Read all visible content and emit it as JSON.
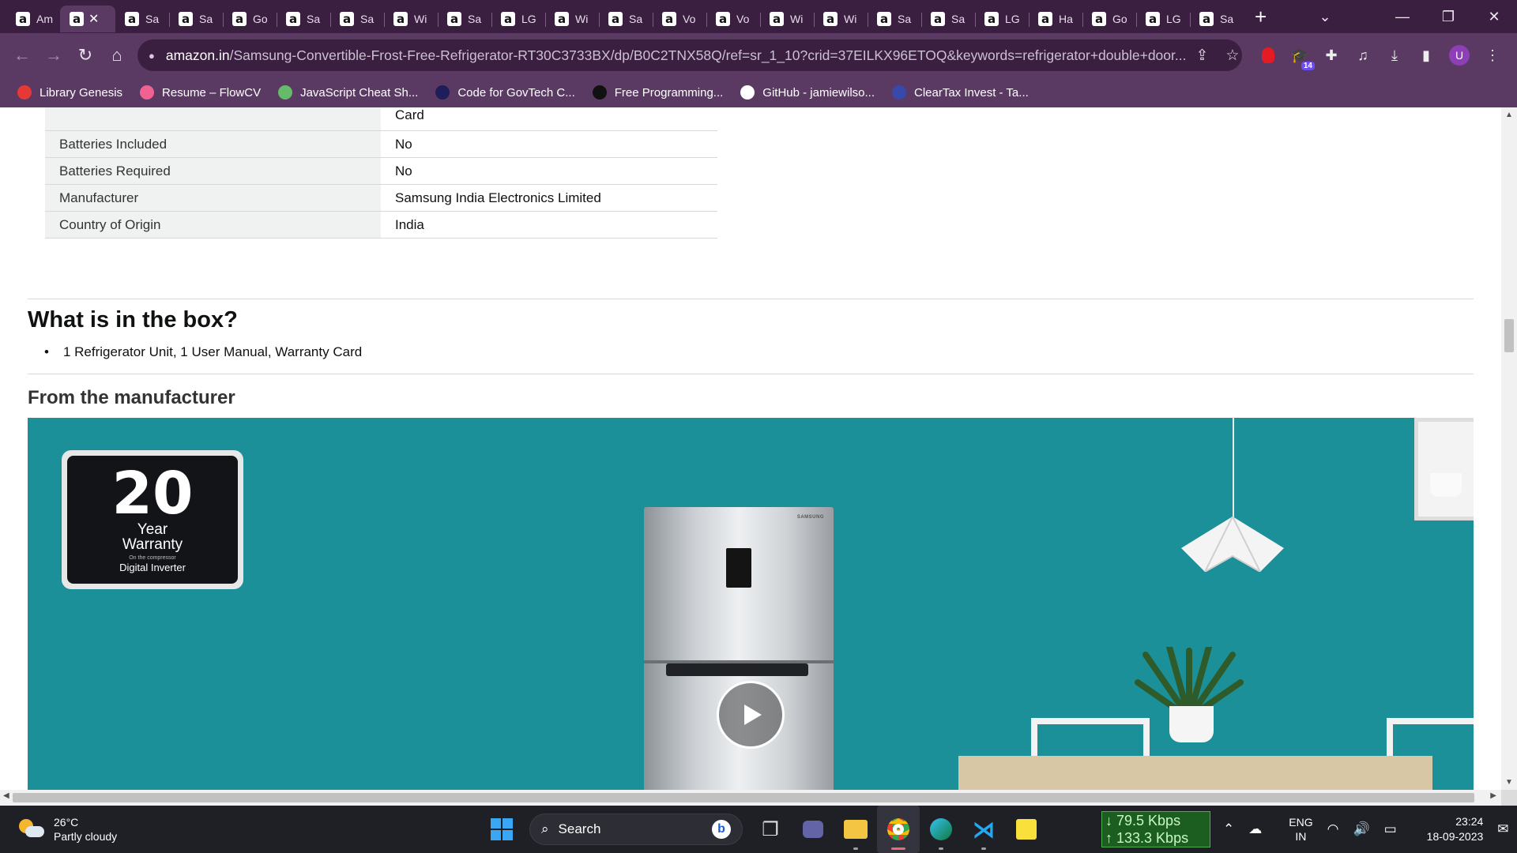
{
  "browser": {
    "tabs": [
      {
        "title": "Am",
        "active": false
      },
      {
        "title": "",
        "active": true
      },
      {
        "title": "Sa",
        "active": false
      },
      {
        "title": "Sa",
        "active": false
      },
      {
        "title": "Go",
        "active": false
      },
      {
        "title": "Sa",
        "active": false
      },
      {
        "title": "Sa",
        "active": false
      },
      {
        "title": "Wi",
        "active": false
      },
      {
        "title": "Sa",
        "active": false
      },
      {
        "title": "LG",
        "active": false
      },
      {
        "title": "Wi",
        "active": false
      },
      {
        "title": "Sa",
        "active": false
      },
      {
        "title": "Vo",
        "active": false
      },
      {
        "title": "Vo",
        "active": false
      },
      {
        "title": "Wi",
        "active": false
      },
      {
        "title": "Wi",
        "active": false
      },
      {
        "title": "Sa",
        "active": false
      },
      {
        "title": "Sa",
        "active": false
      },
      {
        "title": "LG",
        "active": false
      },
      {
        "title": "Ha",
        "active": false
      },
      {
        "title": "Go",
        "active": false
      },
      {
        "title": "LG",
        "active": false
      },
      {
        "title": "Sa",
        "active": false
      }
    ],
    "favicon_glyph": "a",
    "url_host": "amazon.in",
    "url_path": "/Samsung-Convertible-Frost-Free-Refrigerator-RT30C3733BX/dp/B0C2TNX58Q/ref=sr_1_10?crid=37EILKX96ETOQ&keywords=refrigerator+double+door...",
    "profile_initial": "U",
    "extension_badge": "14",
    "bookmarks": [
      {
        "label": "Library Genesis",
        "icon": "library-icon",
        "color": "#e53935"
      },
      {
        "label": "Resume – FlowCV",
        "icon": "flowcv-icon",
        "color": "#f06292"
      },
      {
        "label": "JavaScript Cheat Sh...",
        "icon": "js-icon",
        "color": "#66bb6a"
      },
      {
        "label": "Code for GovTech C...",
        "icon": "un-icon",
        "color": "#1e1e5a"
      },
      {
        "label": "Free Programming...",
        "icon": "book-icon",
        "color": "#111111"
      },
      {
        "label": "GitHub - jamiewilso...",
        "icon": "github-icon",
        "color": "#ffffff"
      },
      {
        "label": "ClearTax Invest - Ta...",
        "icon": "cleartax-icon",
        "color": "#3949ab"
      }
    ]
  },
  "specs": [
    {
      "key": "",
      "value": "Card"
    },
    {
      "key": "Batteries Included",
      "value": "No"
    },
    {
      "key": "Batteries Required",
      "value": "No"
    },
    {
      "key": "Manufacturer",
      "value": "Samsung India Electronics Limited"
    },
    {
      "key": "Country of Origin",
      "value": "India"
    }
  ],
  "box": {
    "heading": "What is in the box?",
    "item": "1 Refrigerator Unit, 1 User Manual, Warranty Card"
  },
  "manufacturer": {
    "heading": "From the manufacturer",
    "warranty_years": "20",
    "warranty_line1": "Year",
    "warranty_line2": "Warranty",
    "warranty_small": "On the compressor",
    "warranty_line3": "Digital Inverter",
    "fridge_brand": "SAMSUNG",
    "banner_color": "#1c9099"
  },
  "taskbar": {
    "temperature": "26°C",
    "condition": "Partly cloudy",
    "search_placeholder": "Search",
    "download_speed": "↓ 79.5 Kbps",
    "upload_speed": "↑ 133.3 Kbps",
    "lang_top": "ENG",
    "lang_bottom": "IN",
    "time": "23:24",
    "date": "18-09-2023"
  }
}
